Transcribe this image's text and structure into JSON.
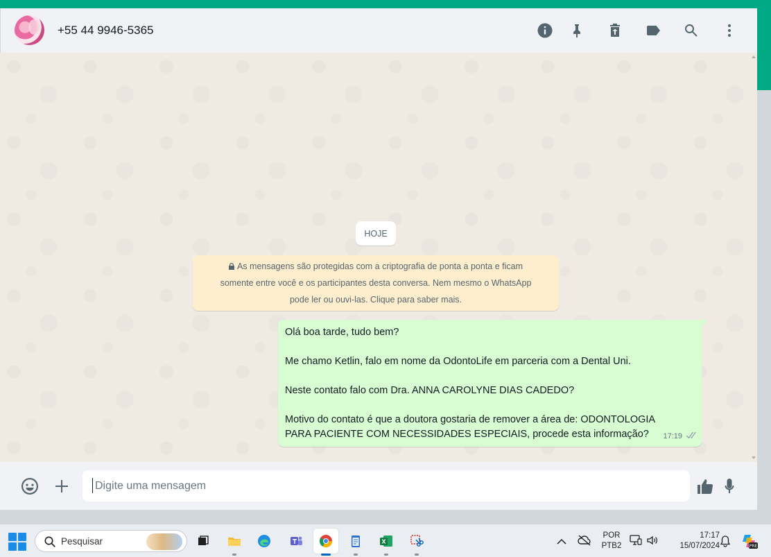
{
  "header": {
    "contact_name": "+55 44 9946-5365",
    "icons": [
      "info-icon",
      "pin-icon",
      "archive-icon",
      "label-icon",
      "search-icon",
      "menu-icon"
    ]
  },
  "chat": {
    "date_label": "HOJE",
    "encryption_notice": "As mensagens são protegidas com a criptografia de ponta a ponta e ficam somente entre você e os participantes desta conversa. Nem mesmo o WhatsApp pode ler ou ouvi-las. Clique para saber mais.",
    "encryption_lines": [
      "As mensagens são protegidas com a criptografia de ponta a ponta e ficam",
      "somente entre você e os participantes desta conversa. Nem mesmo o WhatsApp",
      "pode ler ou ouvi-las. Clique para saber mais."
    ],
    "message": {
      "line1": "Olá boa tarde, tudo bem?",
      "line2": "Me chamo Ketlin, falo em nome da OdontoLife em parceria com a Dental Uni.",
      "line3": "Neste contato falo com Dra. ANNA CAROLYNE DIAS CADEDO?",
      "line4a": "Motivo do contato é que a doutora gostaria de remover a área de: ODONTOLOGIA",
      "line4b": "PARA PACIENTE COM NECESSIDADES ESPECIAIS, procede esta informação?",
      "time": "17:19",
      "status": "delivered"
    }
  },
  "composer": {
    "placeholder": "Digite uma mensagem"
  },
  "taskbar": {
    "search_label": "Pesquisar",
    "apps": [
      "task-view",
      "file-explorer",
      "edge",
      "teams",
      "chrome",
      "notepad",
      "excel",
      "snipping-tool"
    ],
    "active_app": "chrome",
    "language_line1": "POR",
    "language_line2": "PTB2",
    "clock_time": "17:17",
    "clock_date": "15/07/2024"
  },
  "colors": {
    "accent": "#00a884",
    "outgoing_bubble": "#d9fdd3",
    "notice_bg": "#ffeecd",
    "chat_bg": "#efeae2"
  }
}
